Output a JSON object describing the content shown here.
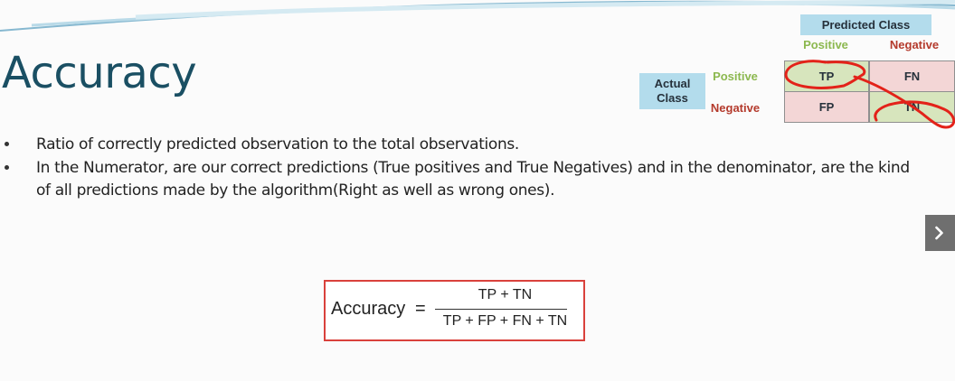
{
  "slide": {
    "title": "Accuracy",
    "bullets": [
      "Ratio of correctly predicted observation to the total observations.",
      "In the Numerator, are our correct predictions (True positives and True Negatives) and in the denominator, are the kind of all predictions made by the algorithm(Right as well as wrong ones)."
    ]
  },
  "formula": {
    "lhs": "Accuracy",
    "equals": "=",
    "numerator": "TP + TN",
    "denominator": "TP + FP + FN + TN"
  },
  "confusion_matrix": {
    "predicted_header": "Predicted Class",
    "actual_header": "Actual Class",
    "col_positive": "Positive",
    "col_negative": "Negative",
    "row_positive": "Positive",
    "row_negative": "Negative",
    "cells": {
      "tp": "TP",
      "fn": "FN",
      "fp": "FP",
      "tn": "TN"
    }
  },
  "colors": {
    "title": "#1a4f63",
    "header_bg": "#b3dcec",
    "positive_label": "#8cb84f",
    "negative_label": "#b43a2c",
    "correct_cell": "#d7e5bd",
    "error_cell": "#f3d6d6",
    "highlight_stroke": "#e32219",
    "formula_border": "#d9413c"
  },
  "navigation": {
    "next_icon": "chevron-right-icon"
  }
}
